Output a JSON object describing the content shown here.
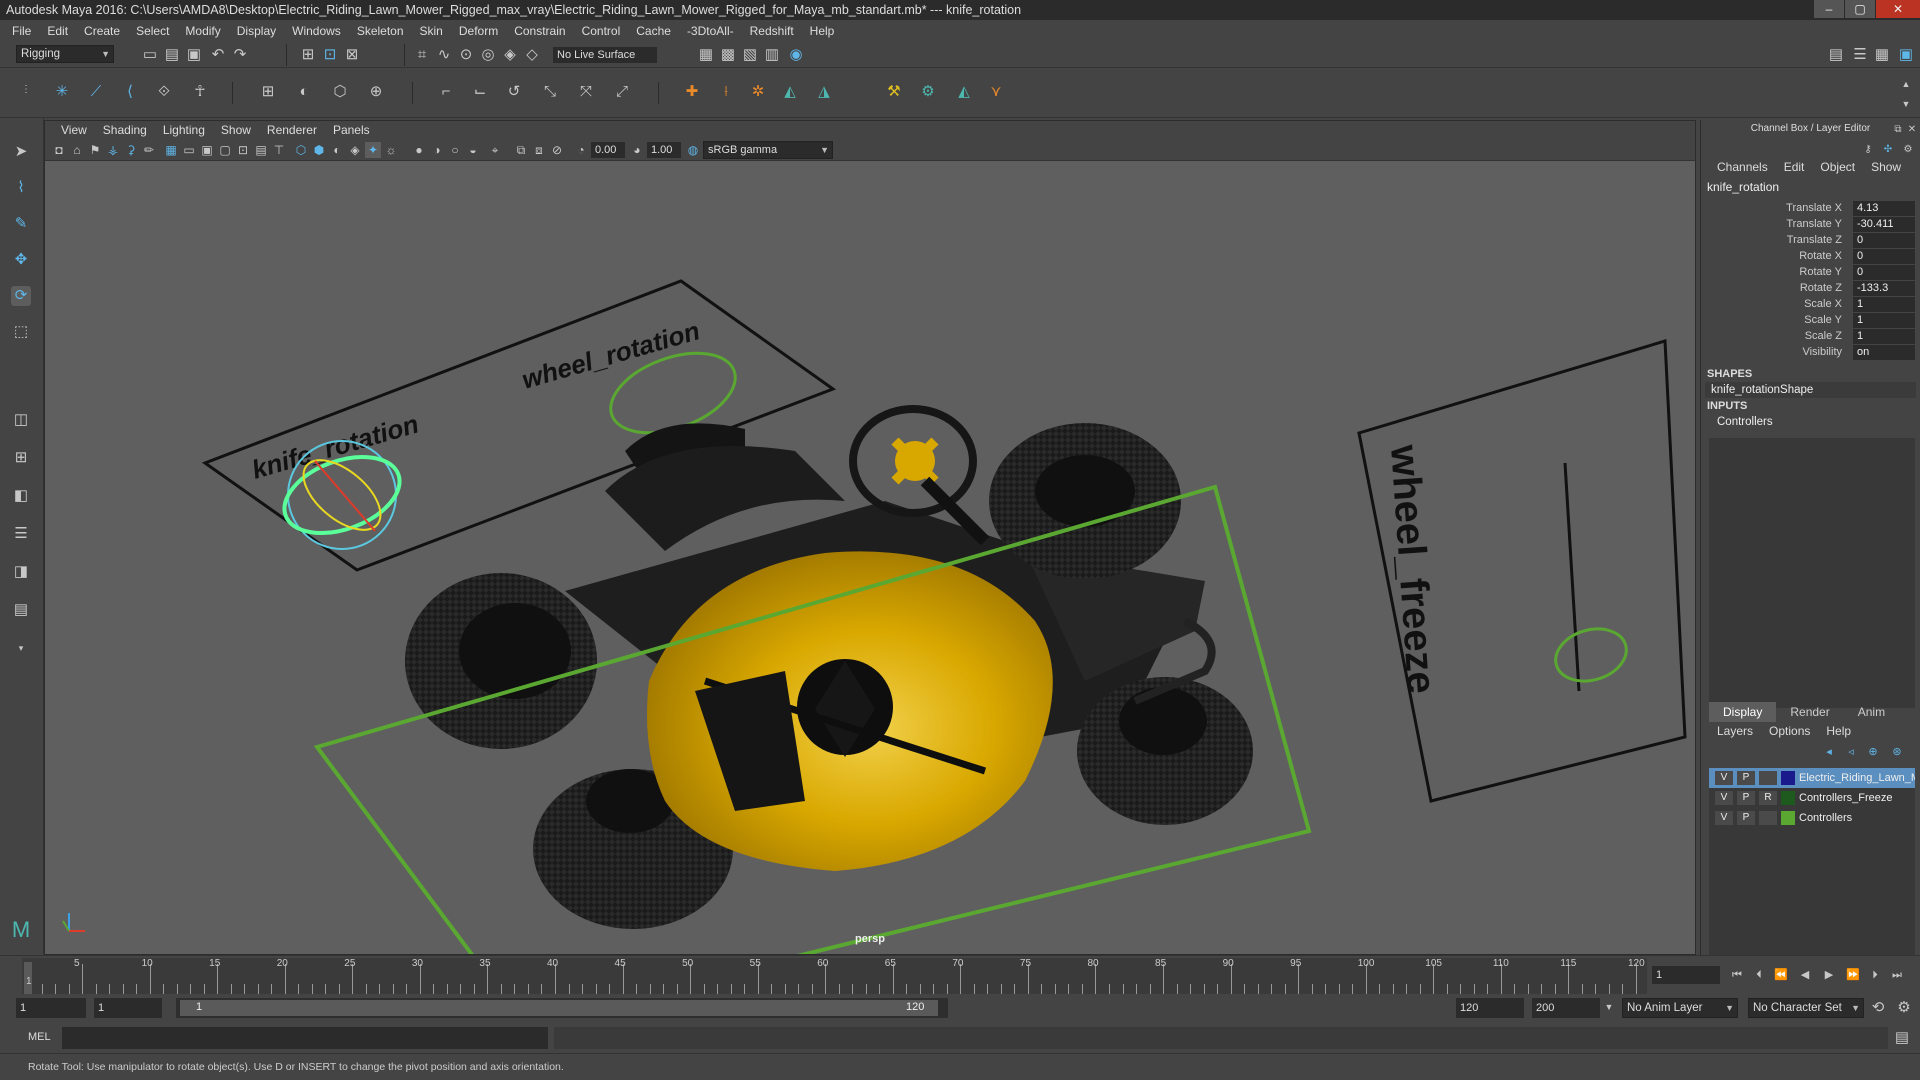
{
  "window": {
    "title": "Autodesk Maya 2016: C:\\Users\\AMDA8\\Desktop\\Electric_Riding_Lawn_Mower_Rigged_max_vray\\Electric_Riding_Lawn_Mower_Rigged_for_Maya_mb_standart.mb*   ---   knife_rotation",
    "minimize": "–",
    "maximize": "▢",
    "close": "✕"
  },
  "menubar": [
    "File",
    "Edit",
    "Create",
    "Select",
    "Modify",
    "Display",
    "Windows",
    "Skeleton",
    "Skin",
    "Deform",
    "Constrain",
    "Control",
    "Cache",
    "-3DtoAll-",
    "Redshift",
    "Help"
  ],
  "statusline": {
    "menuset": "Rigging",
    "live_surface": "No Live Surface"
  },
  "viewport": {
    "menu": [
      "View",
      "Shading",
      "Lighting",
      "Show",
      "Renderer",
      "Panels"
    ],
    "gamma": "sRGB gamma",
    "exposure": "0.00",
    "gamma_value": "1.00",
    "camera_label": "persp",
    "scene_labels": {
      "knife": "knife_rotation",
      "wheel": "wheel_rotation",
      "wheel_freeze": "wheel_freeze"
    }
  },
  "channelbox": {
    "title": "Channel Box / Layer Editor",
    "menu": [
      "Channels",
      "Edit",
      "Object",
      "Show"
    ],
    "object": "knife_rotation",
    "channels": [
      {
        "label": "Translate X",
        "value": "4.13"
      },
      {
        "label": "Translate Y",
        "value": "-30.411"
      },
      {
        "label": "Translate Z",
        "value": "0"
      },
      {
        "label": "Rotate X",
        "value": "0"
      },
      {
        "label": "Rotate Y",
        "value": "0"
      },
      {
        "label": "Rotate Z",
        "value": "-133.3"
      },
      {
        "label": "Scale X",
        "value": "1"
      },
      {
        "label": "Scale Y",
        "value": "1"
      },
      {
        "label": "Scale Z",
        "value": "1"
      },
      {
        "label": "Visibility",
        "value": "on"
      }
    ],
    "shapes_header": "SHAPES",
    "shape": "knife_rotationShape",
    "inputs_header": "INPUTS",
    "input": "Controllers"
  },
  "layer_editor": {
    "tabs": [
      "Display",
      "Render",
      "Anim"
    ],
    "menu": [
      "Layers",
      "Options",
      "Help"
    ],
    "layers": [
      {
        "v": "V",
        "p": "P",
        "r": "",
        "name": "Electric_Riding_Lawn_Mower",
        "color": "#1a1a8c"
      },
      {
        "v": "V",
        "p": "P",
        "r": "R",
        "name": "Controllers_Freeze",
        "color": "#1e5a1e"
      },
      {
        "v": "V",
        "p": "P",
        "r": "",
        "name": "Controllers",
        "color": "#5aa832"
      }
    ]
  },
  "timeline": {
    "ticks": [
      "5",
      "10",
      "15",
      "20",
      "25",
      "30",
      "35",
      "40",
      "45",
      "50",
      "55",
      "60",
      "65",
      "70",
      "75",
      "80",
      "85",
      "90",
      "95",
      "100",
      "105",
      "110",
      "115",
      "120"
    ],
    "current_frame": "1",
    "start": "1",
    "playback_start": "1",
    "range_start": "1",
    "range_end": "120",
    "playback_end": "120",
    "end": "200",
    "anim_layer": "No Anim Layer",
    "character_set": "No Character Set"
  },
  "cmdline": {
    "lang": "MEL"
  },
  "helpline": "Rotate Tool: Use manipulator to rotate object(s). Use D or INSERT to change the pivot position and axis orientation.",
  "colors": {
    "bg": "#444444",
    "viewport": "#5f5f5f",
    "yellow": "#d9a800",
    "green": "#5aa832",
    "select": "#5a8fbf"
  }
}
